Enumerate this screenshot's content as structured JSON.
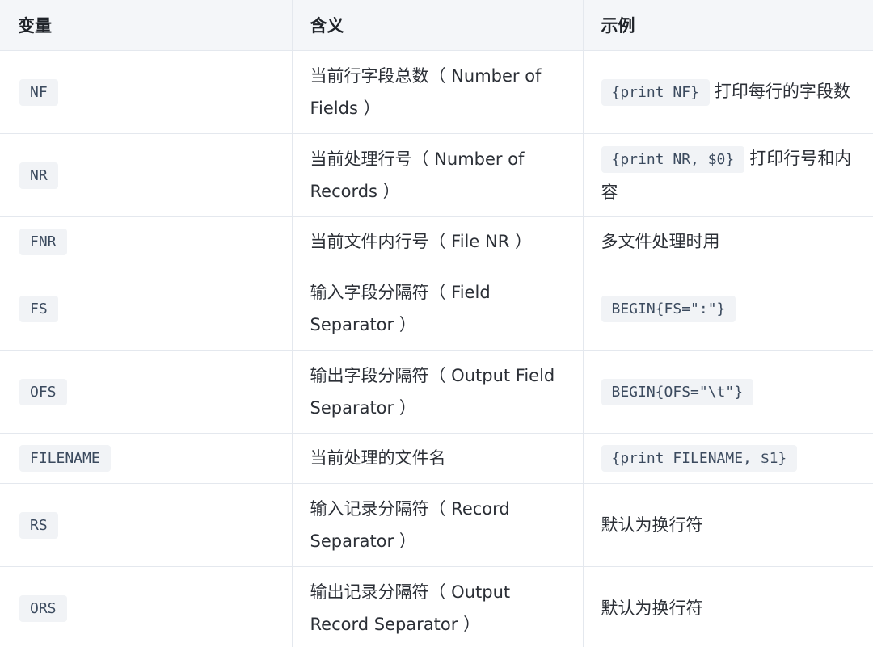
{
  "headers": [
    "变量",
    "含义",
    "示例"
  ],
  "rows": [
    {
      "variable": "NF",
      "meaning": "当前行字段总数（ Number of Fields ）",
      "example_code": "{print NF}",
      "example_text": "打印每行的字段数"
    },
    {
      "variable": "NR",
      "meaning": "当前处理行号（ Number of Records ）",
      "example_code": "{print NR, $0}",
      "example_text": "打印行号和内容"
    },
    {
      "variable": "FNR",
      "meaning": "当前文件内行号（ File NR ）",
      "example_code": "",
      "example_text": "多文件处理时用"
    },
    {
      "variable": "FS",
      "meaning": "输入字段分隔符（ Field Separator ）",
      "example_code": "BEGIN{FS=\":\"}",
      "example_text": ""
    },
    {
      "variable": "OFS",
      "meaning": "输出字段分隔符（ Output Field Separator ）",
      "example_code": "BEGIN{OFS=\"\\t\"}",
      "example_text": ""
    },
    {
      "variable": "FILENAME",
      "meaning": "当前处理的文件名",
      "example_code": "{print FILENAME, $1}",
      "example_text": ""
    },
    {
      "variable": "RS",
      "meaning": "输入记录分隔符（ Record Separator ）",
      "example_code": "",
      "example_text": "默认为换行符"
    },
    {
      "variable": "ORS",
      "meaning": "输出记录分隔符（ Output Record Separator ）",
      "example_code": "",
      "example_text": "默认为换行符"
    }
  ]
}
